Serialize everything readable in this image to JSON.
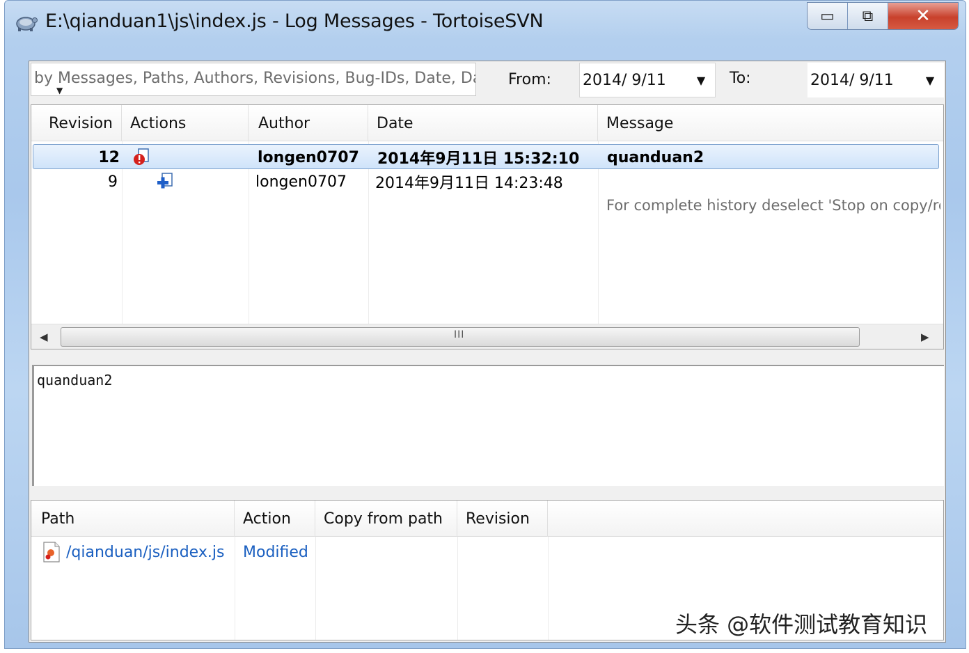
{
  "window": {
    "title": "E:\\qianduan1\\js\\index.js - Log Messages - TortoiseSVN",
    "minimize_label": "▭",
    "maximize_label": "⧉",
    "close_label": "✕"
  },
  "filter": {
    "search_text": "by Messages, Paths, Authors, Revisions, Bug-IDs, Date, Date",
    "from_label": "From:",
    "from_value": "2014/  9/11",
    "to_label": "To:",
    "to_value": "2014/  9/11"
  },
  "revisions": {
    "columns": [
      "Revision",
      "Actions",
      "Author",
      "Date",
      "Message"
    ],
    "rows": [
      {
        "revision": "12",
        "action_icon": "modified-doc-icon",
        "author": "longen0707",
        "date": "2014年9月11日 15:32:10",
        "message": "quanduan2",
        "selected": true
      },
      {
        "revision": "9",
        "action_icon": "added-doc-icon",
        "author": "longen0707",
        "date": "2014年9月11日 14:23:48",
        "message": "",
        "selected": false
      }
    ],
    "note": "For complete history deselect 'Stop on copy/re",
    "scroll_grip": "III"
  },
  "message_pane": {
    "text": "quanduan2"
  },
  "paths": {
    "columns": [
      "Path",
      "Action",
      "Copy from path",
      "Revision"
    ],
    "rows": [
      {
        "path": "/qianduan/js/index.js",
        "action": "Modified",
        "copy_from": "",
        "revision": ""
      }
    ]
  },
  "watermark": "头条 @软件测试教育知识",
  "colors": {
    "accent_link": "#1a5fc0",
    "selection": "#cfe3fa",
    "close_red": "#c8412c"
  }
}
